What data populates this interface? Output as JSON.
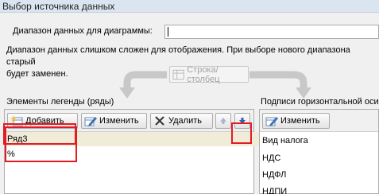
{
  "window": {
    "title": "Выбор источника данных"
  },
  "range": {
    "label": "Диапазон данных для диаграммы:",
    "value": ""
  },
  "warning": {
    "line1": "Диапазон данных слишком сложен для отображения. При выборе нового диапазона старый",
    "line2": "будет заменен."
  },
  "switch_button": {
    "label": "Строка/столбец",
    "icon": "switch-row-column-icon"
  },
  "legend": {
    "title": "Элементы легенды (ряды)",
    "add_label": "Добавить",
    "edit_label": "Изменить",
    "delete_label": "Удалить",
    "items": [
      "Ряд3",
      "%"
    ]
  },
  "axis": {
    "title": "Подписи горизонтальной оси",
    "edit_label": "Изменить",
    "items": [
      "Вид налога",
      "НДС",
      "НДФЛ",
      "НДПИ"
    ]
  },
  "colors": {
    "highlight": "#e31b23",
    "title_bar": "#dbe5f1",
    "selected_row": "#f0ecd8"
  }
}
